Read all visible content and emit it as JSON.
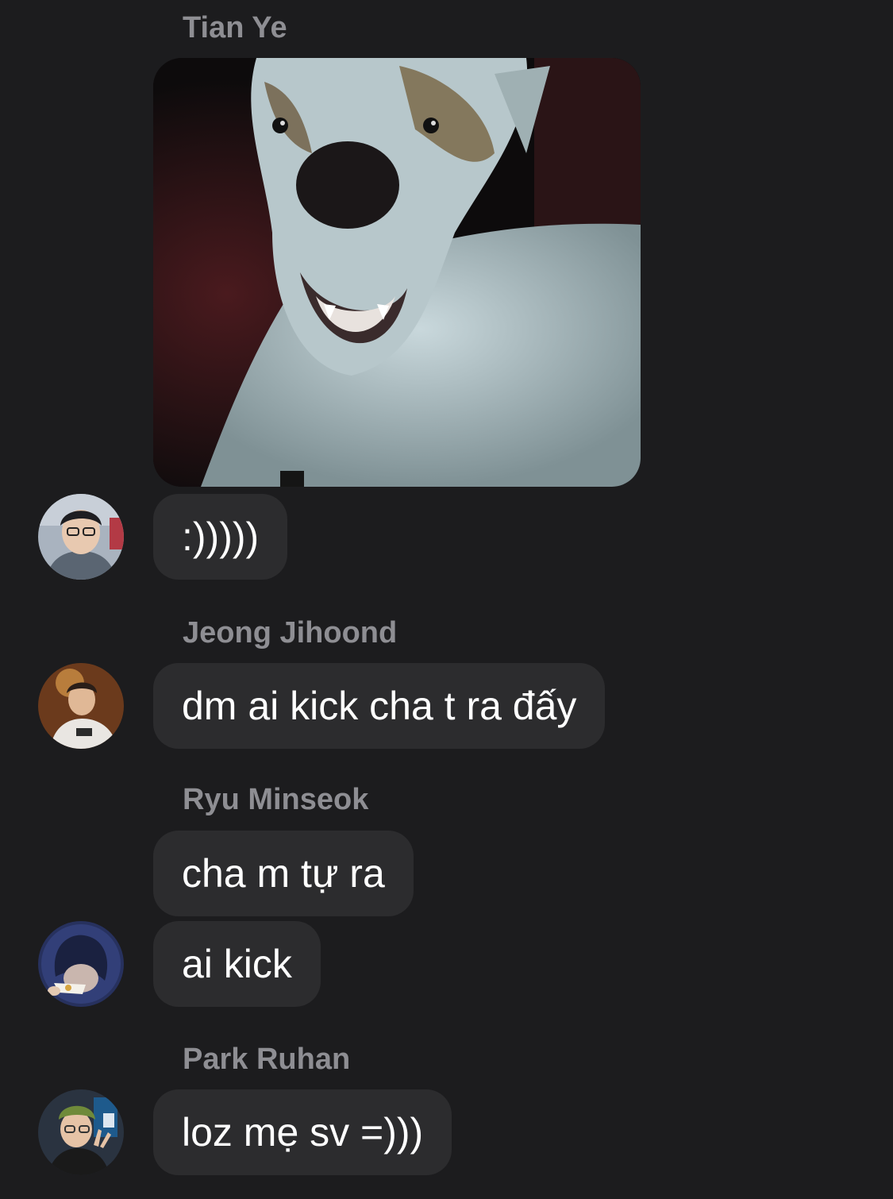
{
  "messages": {
    "sender_1": "Tian Ye",
    "bubble_1": ":)))))",
    "sender_2": "Jeong Jihoond",
    "bubble_2": "dm ai kick cha t ra đấy",
    "sender_3": "Ryu Minseok",
    "bubble_3a": "cha m tự ra",
    "bubble_3b": "ai kick",
    "sender_4": "Park Ruhan",
    "bubble_4": "loz mẹ sv =)))"
  },
  "colors": {
    "background": "#1c1c1e",
    "bubble": "#2c2c2e",
    "sender_name": "#8e8e93",
    "text": "#ffffff"
  }
}
